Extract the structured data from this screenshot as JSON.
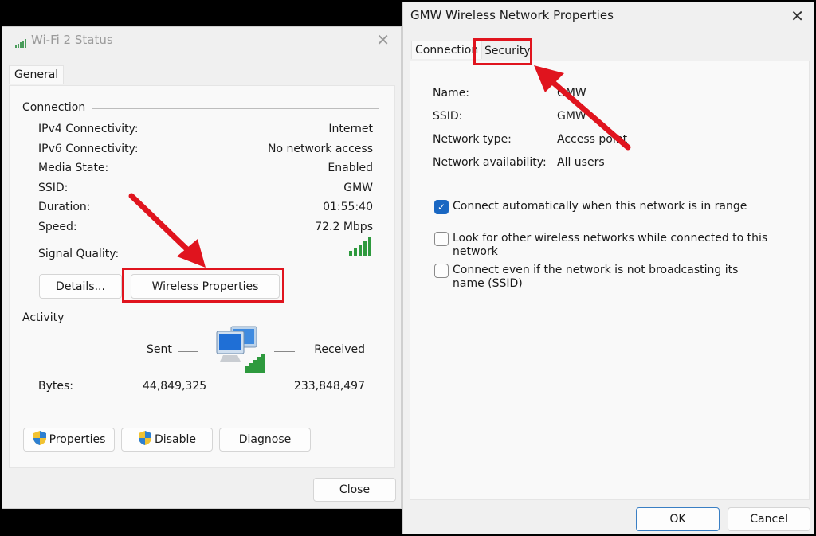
{
  "status_window": {
    "title": "Wi-Fi 2 Status",
    "tab": "General",
    "connection_label": "Connection",
    "rows": [
      {
        "label": "IPv4 Connectivity:",
        "value": "Internet"
      },
      {
        "label": "IPv6 Connectivity:",
        "value": "No network access"
      },
      {
        "label": "Media State:",
        "value": "Enabled"
      },
      {
        "label": "SSID:",
        "value": "GMW"
      },
      {
        "label": "Duration:",
        "value": "01:55:40"
      },
      {
        "label": "Speed:",
        "value": "72.2 Mbps"
      }
    ],
    "signal_label": "Signal Quality:",
    "signal_bars": 5,
    "details_button": "Details...",
    "wireless_properties_button": "Wireless Properties",
    "activity_label": "Activity",
    "sent_label": "Sent",
    "received_label": "Received",
    "bytes_label": "Bytes:",
    "bytes_sent": "44,849,325",
    "bytes_received": "233,848,497",
    "properties_button": "Properties",
    "disable_button": "Disable",
    "diagnose_button": "Diagnose",
    "close_button": "Close"
  },
  "props_window": {
    "title": "GMW Wireless Network Properties",
    "tabs": [
      "Connection",
      "Security"
    ],
    "props": [
      {
        "label": "Name:",
        "value": "GMW"
      },
      {
        "label": "SSID:",
        "value": "GMW"
      },
      {
        "label": "Network type:",
        "value": "Access point"
      },
      {
        "label": "Network availability:",
        "value": "All users"
      }
    ],
    "options": [
      {
        "label": "Connect automatically when this network is in range",
        "checked": true
      },
      {
        "label": "Look for other wireless networks while connected to this network",
        "checked": false
      },
      {
        "label": "Connect even if the network is not broadcasting its name (SSID)",
        "checked": false
      }
    ],
    "ok_button": "OK",
    "cancel_button": "Cancel"
  },
  "colors": {
    "highlight": "#e0141e",
    "checkbox_accent": "#1a67c2",
    "signal_green": "#2e9a3e"
  }
}
